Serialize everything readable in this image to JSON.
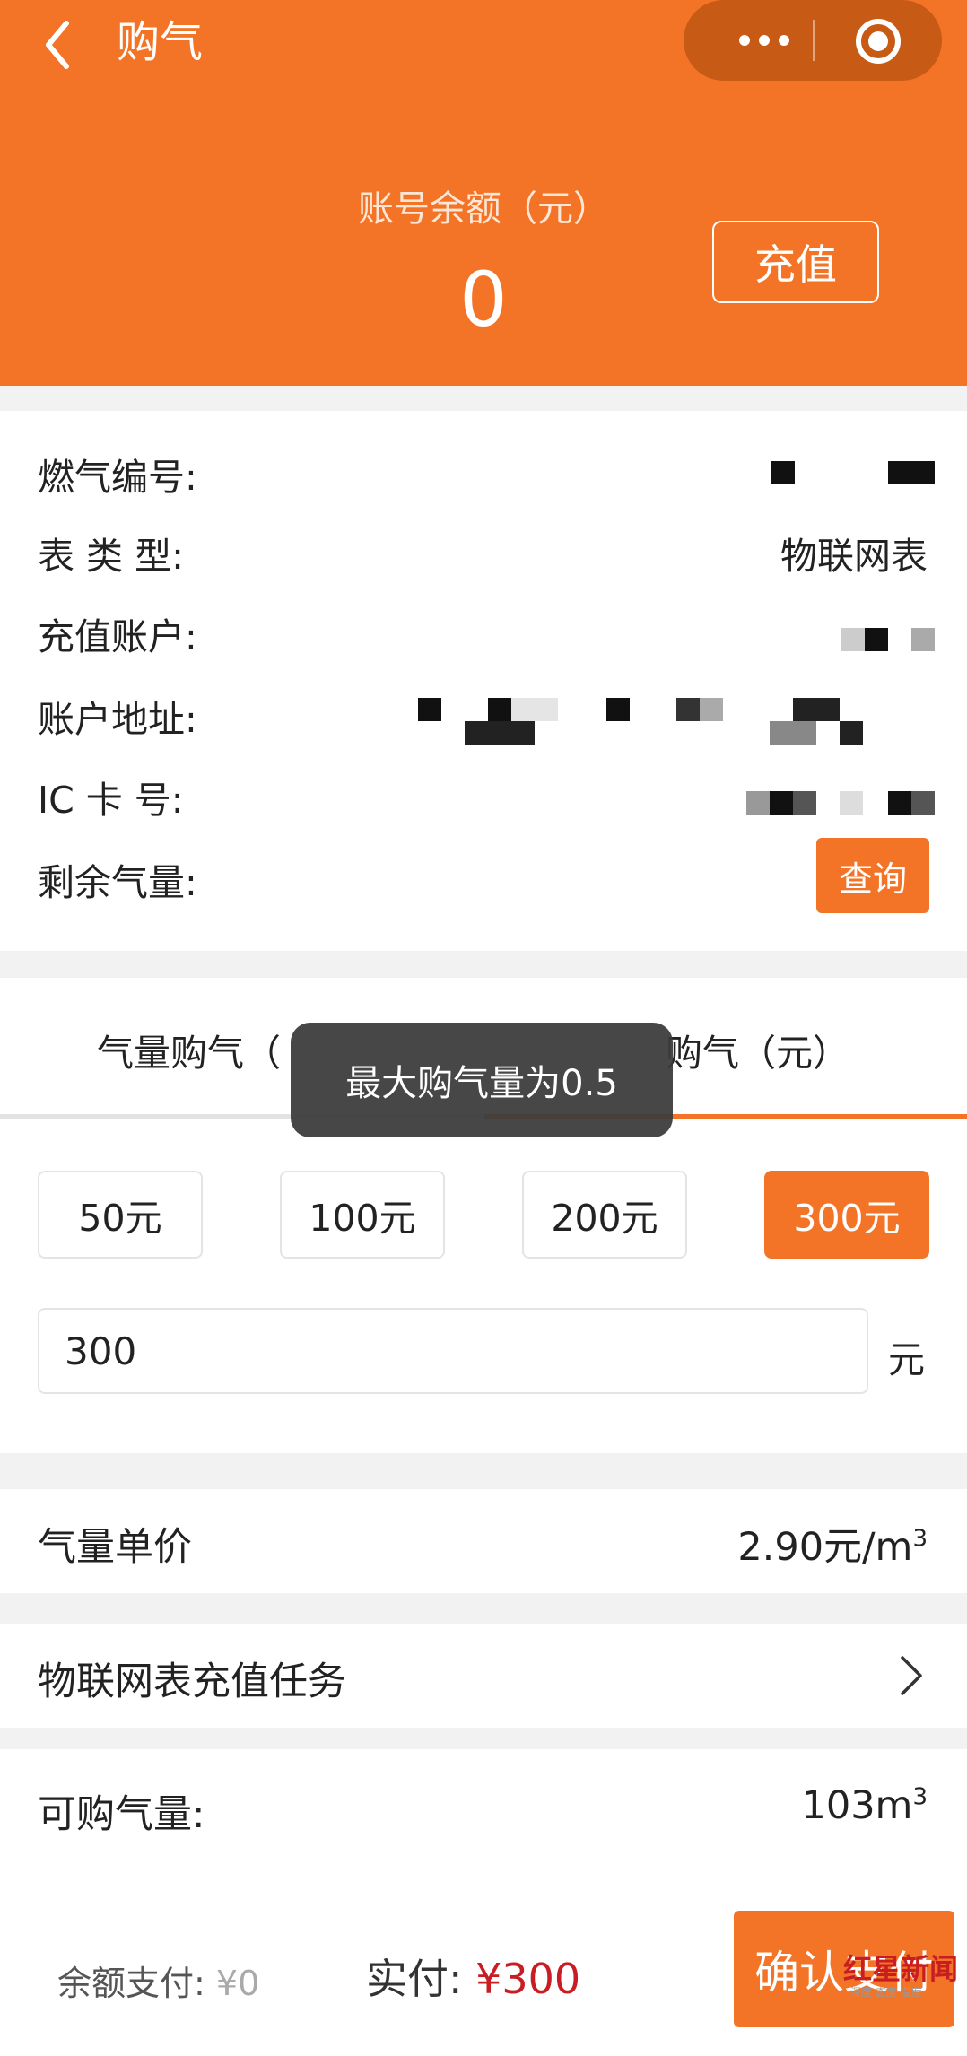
{
  "header": {
    "title": "购气",
    "balance_label": "账号余额（元）",
    "balance_value": "0",
    "recharge_label": "充值"
  },
  "info": {
    "gas_no_label": "燃气编号:",
    "meter_type_label": "表 类 型:",
    "meter_type_value": "物联网表",
    "recharge_account_label": "充值账户:",
    "address_label": "账户地址:",
    "ic_label": "IC  卡  号:",
    "remaining_gas_label": "剩余气量:",
    "query_label": "查询"
  },
  "purchase": {
    "tab_left": "气量购气（",
    "tab_right": "购气（元）",
    "amounts": [
      "50元",
      "100元",
      "200元",
      "300元"
    ],
    "selected_amount_index": 3,
    "input_value": "300",
    "unit": "元"
  },
  "toast": "最大购气量为0.5",
  "unit_price": {
    "label": "气量单价",
    "value": "2.90元/m",
    "sup": "3"
  },
  "task": {
    "label": "物联网表充值任务"
  },
  "available": {
    "label": "可购气量:",
    "value": "103m",
    "sup": "3"
  },
  "bottom_bar": {
    "balance_pay_label": "余额支付:",
    "balance_pay_value": "¥0",
    "actual_label": "实付:",
    "actual_value": "¥300",
    "confirm_label": "确认支付"
  },
  "watermark": {
    "text": "红星新闻",
    "sub": "深度 态度 温度"
  },
  "colors": {
    "brand": "#f37426",
    "price_red": "#c71d23",
    "toast_bg": "#3c3c3c"
  }
}
